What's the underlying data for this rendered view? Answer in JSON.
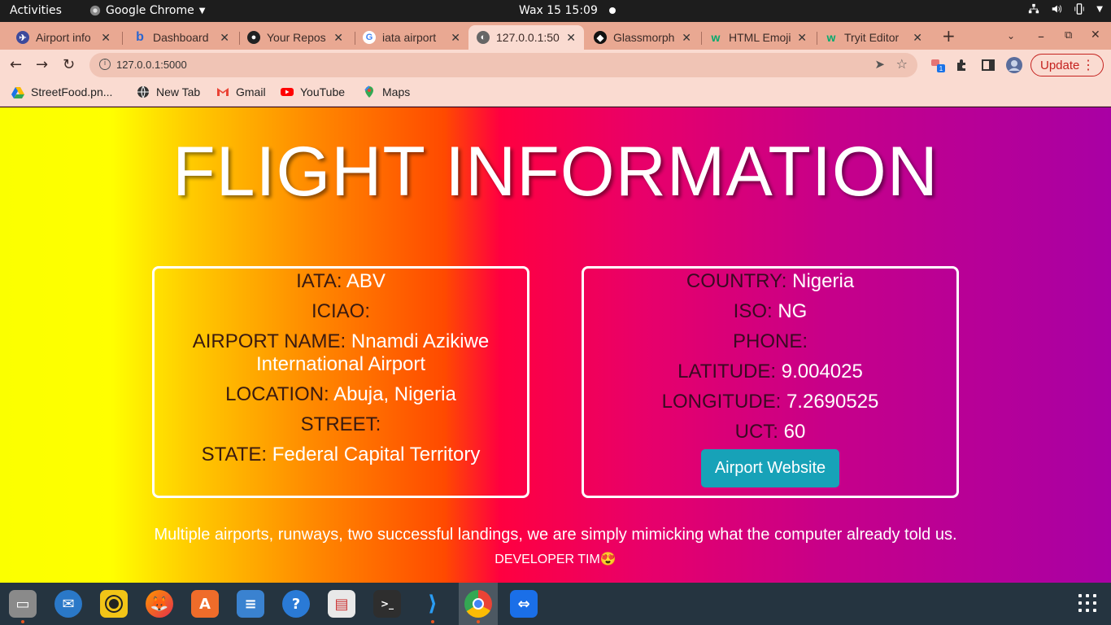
{
  "topbar": {
    "activities": "Activities",
    "app_name": "Google Chrome",
    "clock": "Wax 15  15:09"
  },
  "tabs": [
    {
      "title": "Airport info"
    },
    {
      "title": "Dashboard"
    },
    {
      "title": "Your Repos"
    },
    {
      "title": "iata airport"
    },
    {
      "title": "127.0.0.1:50",
      "active": true
    },
    {
      "title": "Glassmorph"
    },
    {
      "title": "HTML Emoji"
    },
    {
      "title": "Tryit Editor"
    }
  ],
  "toolbar": {
    "url": "127.0.0.1:5000",
    "update_label": "Update",
    "extension_badge": "1"
  },
  "bookmarks": [
    {
      "label": "StreetFood.pn..."
    },
    {
      "label": "New Tab"
    },
    {
      "label": "Gmail"
    },
    {
      "label": "YouTube"
    },
    {
      "label": "Maps"
    }
  ],
  "page": {
    "title": "FLIGHT INFORMATION",
    "left_card": {
      "iata_label": "IATA:",
      "iata_value": "ABV",
      "icao_label": "ICIAO:",
      "icao_value": "",
      "name_label": "AIRPORT NAME:",
      "name_value": "Nnamdi Azikiwe International Airport",
      "location_label": "LOCATION:",
      "location_value": "Abuja, Nigeria",
      "street_label": "STREET:",
      "street_value": "",
      "state_label": "STATE:",
      "state_value": "Federal Capital Territory"
    },
    "right_card": {
      "country_label": "COUNTRY:",
      "country_value": "Nigeria",
      "iso_label": "ISO:",
      "iso_value": "NG",
      "phone_label": "PHONE:",
      "phone_value": "",
      "lat_label": "LATITUDE:",
      "lat_value": "9.004025",
      "lon_label": "LONGITUDE:",
      "lon_value": "7.2690525",
      "uct_label": "UCT:",
      "uct_value": "60",
      "website_button": "Airport Website"
    },
    "footer": "Multiple airports, runways, two successful landings, we are simply mimicking what the computer already told us.",
    "credit": "DEVELOPER TIM😍"
  },
  "colors": {
    "accent_button": "#17a2b8",
    "update_red": "#c5221f"
  },
  "dock": [
    {
      "icon": "files-icon"
    },
    {
      "icon": "thunderbird-icon"
    },
    {
      "icon": "rhythmbox-icon"
    },
    {
      "icon": "firefox-icon"
    },
    {
      "icon": "software-center-icon"
    },
    {
      "icon": "text-editor-icon"
    },
    {
      "icon": "help-icon"
    },
    {
      "icon": "document-viewer-icon"
    },
    {
      "icon": "terminal-icon"
    },
    {
      "icon": "vscode-icon"
    },
    {
      "icon": "chrome-icon"
    },
    {
      "icon": "teamviewer-icon"
    }
  ]
}
